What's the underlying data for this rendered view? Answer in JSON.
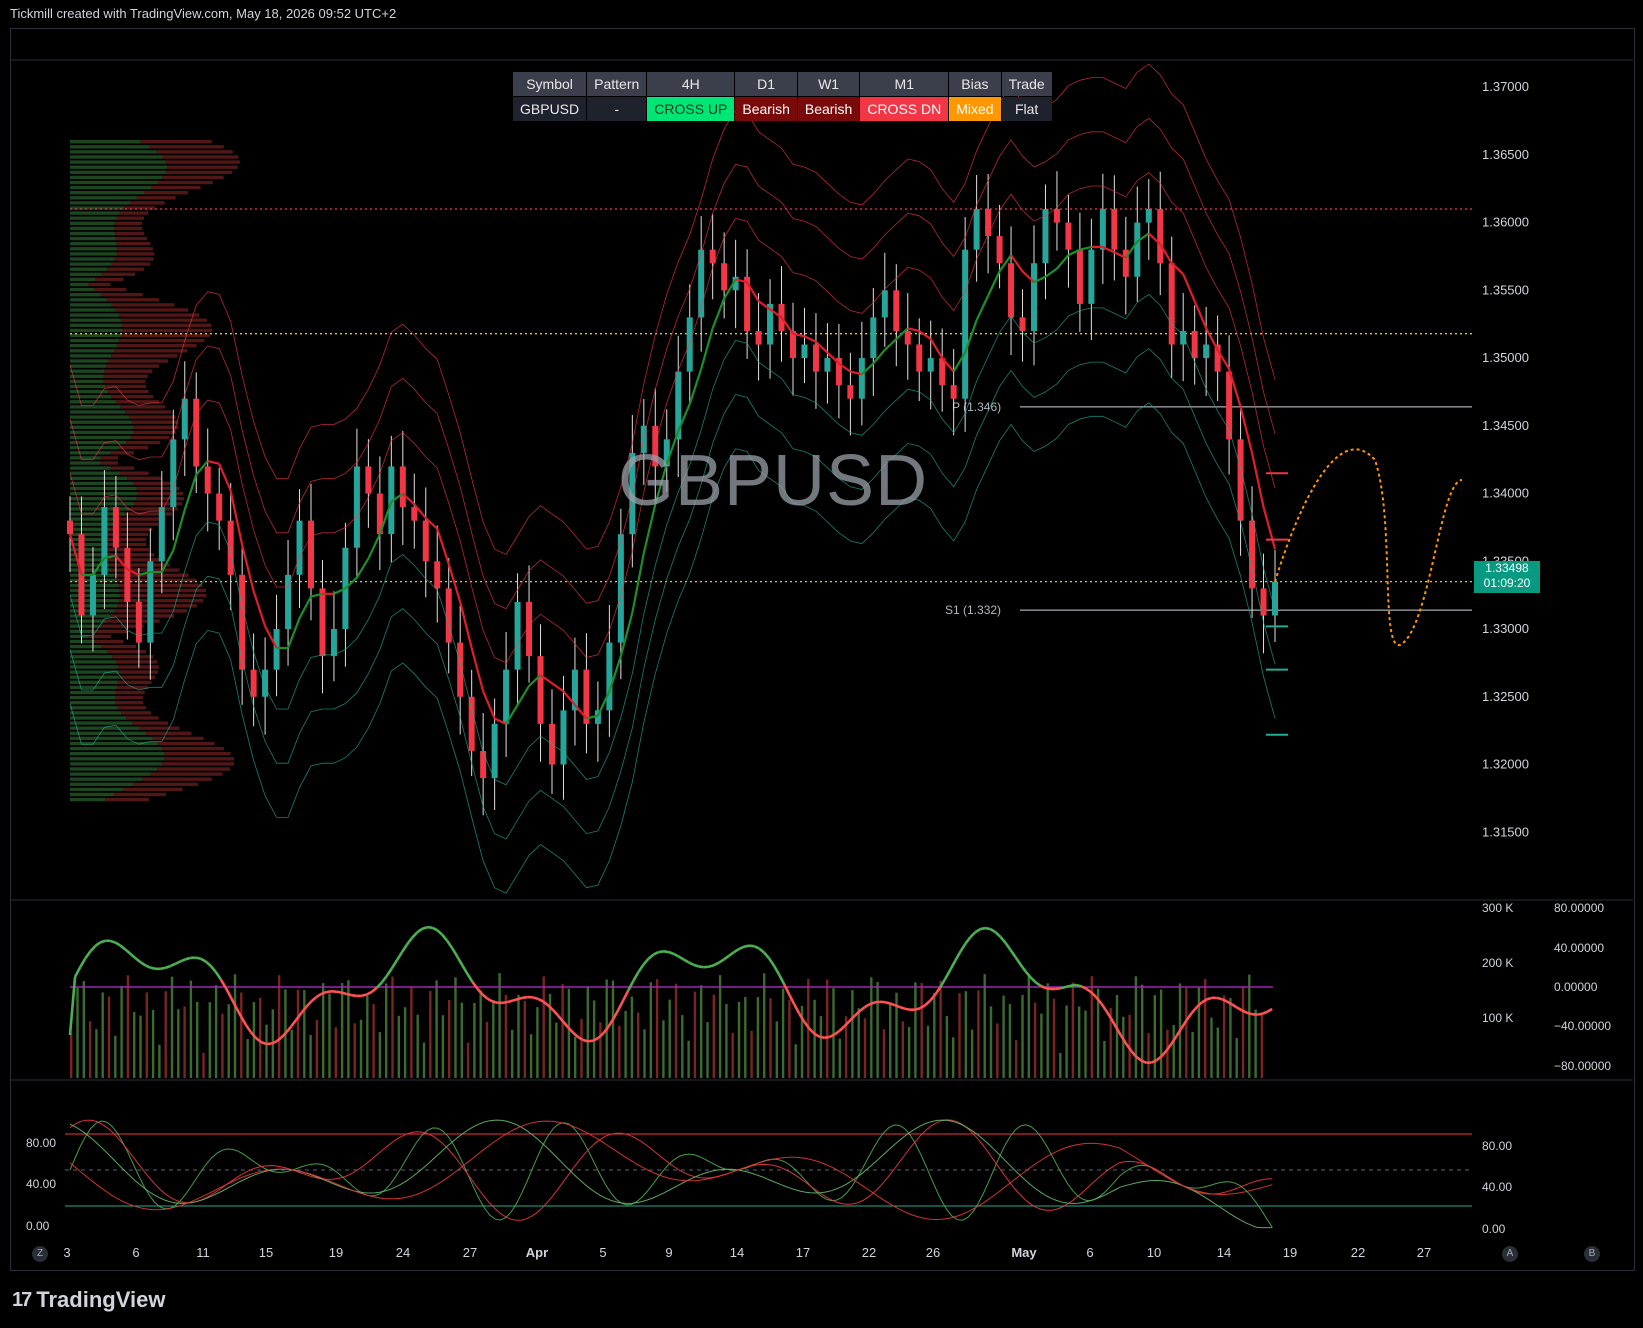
{
  "header": {
    "title": "Tickmill created with TradingView.com, May 18, 2026 09:52 UTC+2"
  },
  "watermark": "GBPUSD",
  "signal_table": {
    "headers": [
      "Symbol",
      "Pattern",
      "4H",
      "D1",
      "W1",
      "M1",
      "Bias",
      "Trade"
    ],
    "cells": [
      {
        "text": "GBPUSD",
        "bg": "#1e222d",
        "fg": "#e8e8e8"
      },
      {
        "text": "-",
        "bg": "#1e222d",
        "fg": "#e8e8e8"
      },
      {
        "text": "CROSS UP",
        "bg": "#00e676",
        "fg": "#0a3d1c"
      },
      {
        "text": "Bearish",
        "bg": "#7a0a0a",
        "fg": "#ffffff"
      },
      {
        "text": "Bearish",
        "bg": "#7a0a0a",
        "fg": "#ffffff"
      },
      {
        "text": "CROSS DN",
        "bg": "#f23645",
        "fg": "#ffffff"
      },
      {
        "text": "Mixed",
        "bg": "#ff9800",
        "fg": "#ffffff"
      },
      {
        "text": "Flat",
        "bg": "#1e222d",
        "fg": "#e8e8e8"
      }
    ]
  },
  "price_tag": {
    "price": "1.33498",
    "countdown": "01:09:20"
  },
  "pivot_labels": {
    "p": "P (1.346)",
    "s1": "S1 (1.332)"
  },
  "footer": {
    "brand": "TradingView"
  },
  "corner_buttons": {
    "left": "Z",
    "a": "A",
    "b": "B"
  },
  "chart_data": [
    {
      "type": "candlestick",
      "symbol": "GBPUSD",
      "y_ticks": [
        "1.37000",
        "1.36500",
        "1.36000",
        "1.35500",
        "1.35000",
        "1.34500",
        "1.34000",
        "1.33500",
        "1.33000",
        "1.32500",
        "1.32000",
        "1.31500"
      ],
      "ylim": [
        1.31,
        1.372
      ],
      "x_ticks": [
        "3",
        "6",
        "11",
        "15",
        "19",
        "24",
        "27",
        "Apr",
        "5",
        "9",
        "14",
        "17",
        "22",
        "26",
        "May",
        "6",
        "10",
        "14",
        "19",
        "22",
        "27"
      ],
      "close_series": [
        1.337,
        1.331,
        1.334,
        1.339,
        1.336,
        1.332,
        1.329,
        1.335,
        1.339,
        1.344,
        1.347,
        1.342,
        1.34,
        1.338,
        1.334,
        1.327,
        1.325,
        1.327,
        1.33,
        1.334,
        1.338,
        1.333,
        1.328,
        1.33,
        1.336,
        1.342,
        1.34,
        1.337,
        1.342,
        1.339,
        1.338,
        1.335,
        1.333,
        1.329,
        1.325,
        1.321,
        1.319,
        1.323,
        1.327,
        1.332,
        1.328,
        1.323,
        1.32,
        1.324,
        1.327,
        1.323,
        1.324,
        1.329,
        1.337,
        1.343,
        1.345,
        1.342,
        1.344,
        1.349,
        1.353,
        1.358,
        1.357,
        1.355,
        1.356,
        1.352,
        1.351,
        1.354,
        1.352,
        1.35,
        1.351,
        1.349,
        1.35,
        1.348,
        1.347,
        1.35,
        1.353,
        1.355,
        1.352,
        1.351,
        1.349,
        1.35,
        1.348,
        1.347,
        1.358,
        1.361,
        1.359,
        1.357,
        1.353,
        1.352,
        1.357,
        1.361,
        1.36,
        1.358,
        1.354,
        1.358,
        1.361,
        1.358,
        1.356,
        1.36,
        1.361,
        1.357,
        1.351,
        1.352,
        1.35,
        1.351,
        1.349,
        1.344,
        1.338,
        1.333,
        1.331,
        1.3335
      ],
      "trend_band": {
        "upper_line_color": "#f23645",
        "lower_line_color": "#22ab94"
      },
      "pivot_lines": {
        "p": 1.3464,
        "s1": 1.3314
      },
      "horizontal_levels": [
        {
          "value": 1.361,
          "color": "#f23645",
          "style": "dotted"
        },
        {
          "value": 1.3518,
          "color": "#e6c229",
          "style": "dotted"
        },
        {
          "value": 1.3335,
          "color": "#e6c229",
          "style": "dotted"
        }
      ],
      "target_ticks": [
        {
          "value": 1.3415,
          "color": "#f23645"
        },
        {
          "value": 1.3366,
          "color": "#f23645"
        },
        {
          "value": 1.3302,
          "color": "#22ab94"
        },
        {
          "value": 1.327,
          "color": "#22ab94"
        },
        {
          "value": 1.3222,
          "color": "#22ab94"
        }
      ],
      "projection": {
        "color": "#ff9800",
        "style": "dotted"
      },
      "grid": false
    },
    {
      "type": "line+bar",
      "panel": "oscillator-volume",
      "volume_ticks": [
        "300 K",
        "200 K",
        "100 K"
      ],
      "oscillator_ticks": [
        "80.00000",
        "40.00000",
        "0.00000",
        "−40.00000",
        "−80.00000"
      ],
      "zero_line_color": "#9c27b0",
      "positive_color": "#4caf50",
      "negative_color": "#ff5252"
    },
    {
      "type": "line",
      "panel": "stochastic",
      "ticks": [
        "80.00",
        "40.00",
        "0.00"
      ],
      "ylim": [
        0,
        100
      ],
      "levels": [
        {
          "value": 80,
          "color": "#f23645"
        },
        {
          "value": 50,
          "color": "#5d606b"
        },
        {
          "value": 20,
          "color": "#22ab94"
        }
      ]
    }
  ]
}
